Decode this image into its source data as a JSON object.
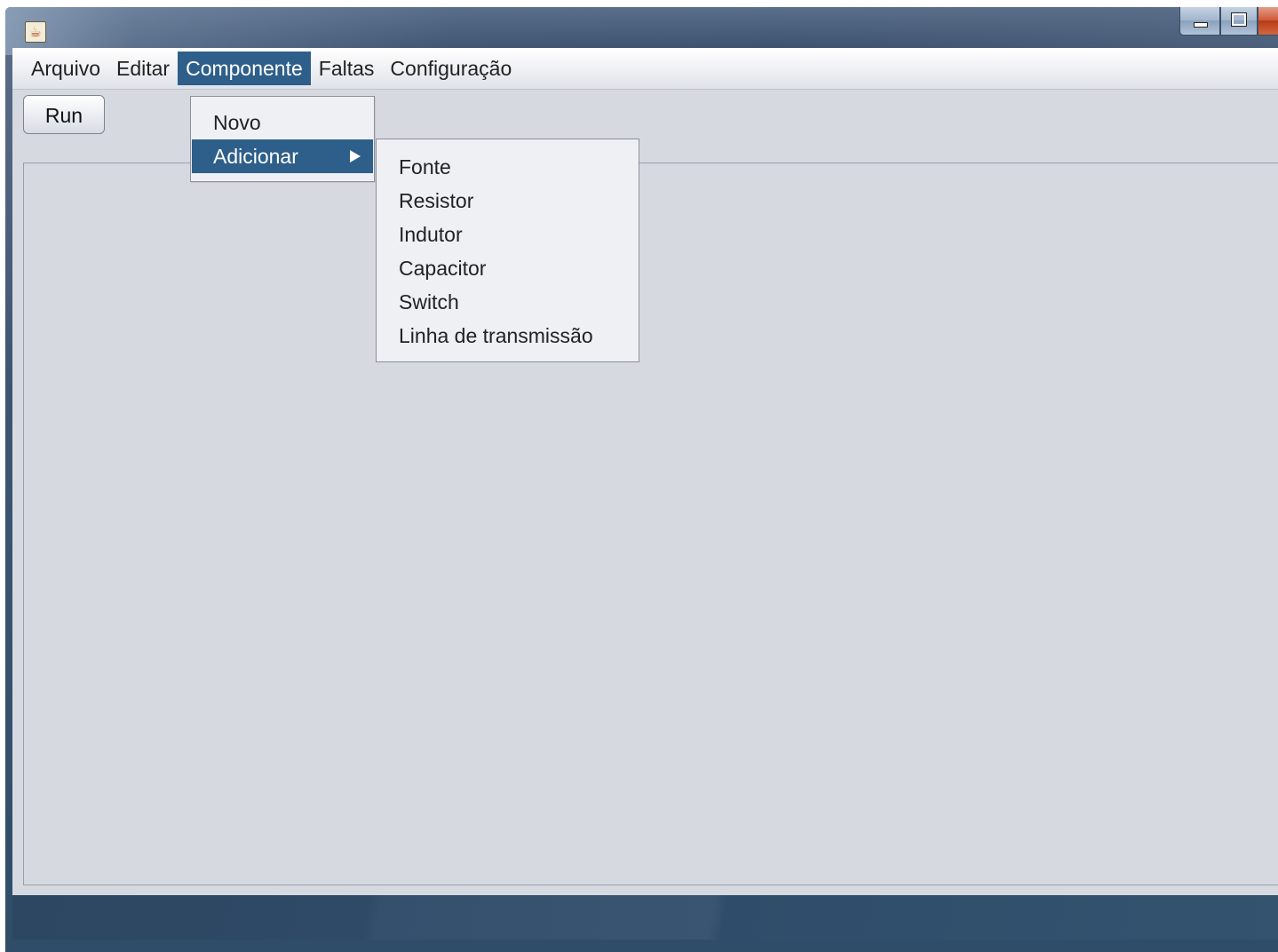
{
  "window": {
    "controls": [
      "minimize-icon",
      "maximize-icon",
      "close-icon"
    ]
  },
  "menubar": {
    "items": [
      {
        "label": "Arquivo"
      },
      {
        "label": "Editar"
      },
      {
        "label": "Componente",
        "active": true
      },
      {
        "label": "Faltas"
      },
      {
        "label": "Configuração"
      }
    ]
  },
  "toolbar": {
    "run_label": "Run"
  },
  "componente_menu": {
    "items": [
      {
        "label": "Novo"
      },
      {
        "label": "Adicionar",
        "active": true,
        "has_submenu": true
      }
    ]
  },
  "adicionar_submenu": {
    "items": [
      {
        "label": "Fonte"
      },
      {
        "label": "Resistor"
      },
      {
        "label": "Indutor"
      },
      {
        "label": "Capacitor"
      },
      {
        "label": "Switch"
      },
      {
        "label": "Linha de transmissão"
      }
    ]
  },
  "colors": {
    "menu_highlight": "#2e5f8a",
    "client_background": "#d6d9e0"
  }
}
